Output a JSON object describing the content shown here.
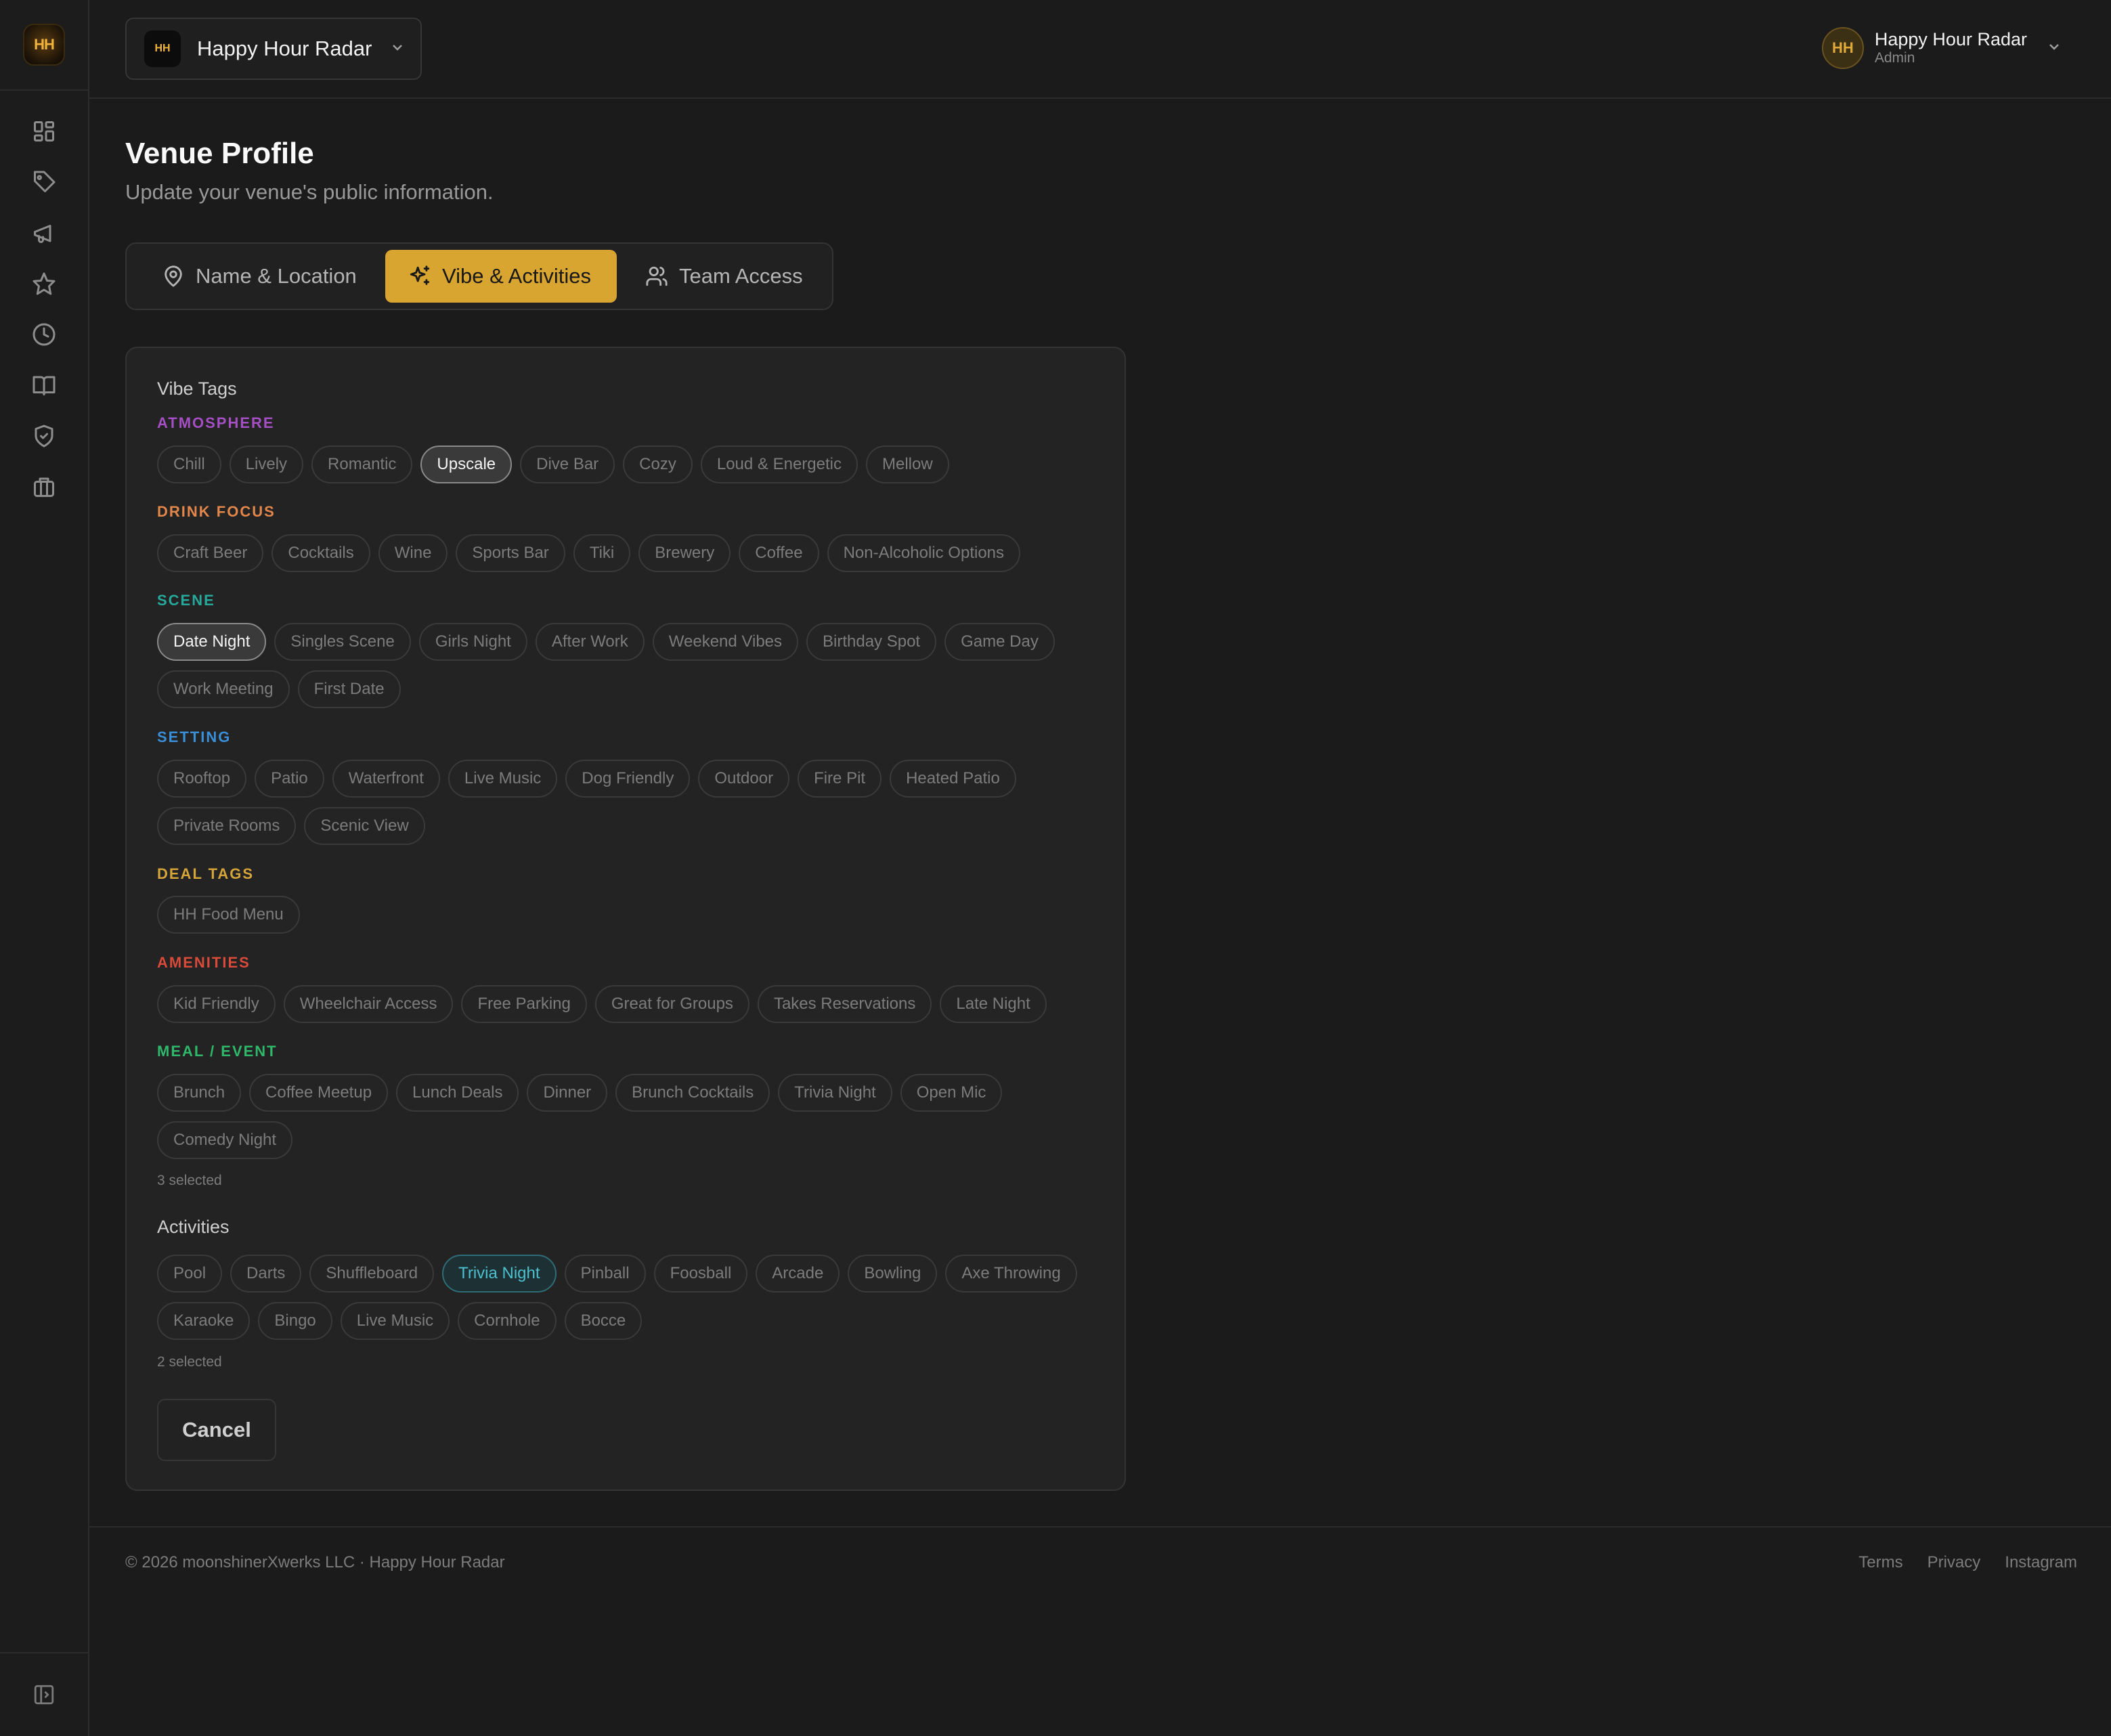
{
  "app": {
    "logo_text": "HH",
    "venue_name": "Happy Hour Radar",
    "user_initials": "HH",
    "user_name": "Happy Hour Radar",
    "user_role": "Admin"
  },
  "sidebar": {
    "items": [
      {
        "icon": "dashboard-icon"
      },
      {
        "icon": "tag-icon"
      },
      {
        "icon": "megaphone-icon"
      },
      {
        "icon": "star-icon"
      },
      {
        "icon": "clock-icon"
      },
      {
        "icon": "book-icon"
      },
      {
        "icon": "shield-check-icon"
      },
      {
        "icon": "briefcase-icon"
      }
    ],
    "bottom_icon": "panel-expand-icon"
  },
  "page": {
    "title": "Venue Profile",
    "subtitle": "Update your venue's public information."
  },
  "tabs": [
    {
      "label": "Name & Location",
      "icon": "map-pin-icon",
      "active": false
    },
    {
      "label": "Vibe & Activities",
      "icon": "sparkles-icon",
      "active": true
    },
    {
      "label": "Team Access",
      "icon": "users-icon",
      "active": false
    }
  ],
  "vibe": {
    "label": "Vibe Tags",
    "categories": [
      {
        "name": "ATMOSPHERE",
        "color": "#a54fc4",
        "tags": [
          "Chill",
          "Lively",
          "Romantic",
          "Upscale",
          "Dive Bar",
          "Cozy",
          "Loud & Energetic",
          "Mellow"
        ],
        "selected": [
          "Upscale"
        ]
      },
      {
        "name": "DRINK FOCUS",
        "color": "#e2864a",
        "tags": [
          "Craft Beer",
          "Cocktails",
          "Wine",
          "Sports Bar",
          "Tiki",
          "Brewery",
          "Coffee",
          "Non-Alcoholic Options"
        ],
        "selected": []
      },
      {
        "name": "SCENE",
        "color": "#26a89a",
        "tags": [
          "Date Night",
          "Singles Scene",
          "Girls Night",
          "After Work",
          "Weekend Vibes",
          "Birthday Spot",
          "Game Day",
          "Work Meeting",
          "First Date"
        ],
        "selected": [
          "Date Night"
        ]
      },
      {
        "name": "SETTING",
        "color": "#3a8fd9",
        "tags": [
          "Rooftop",
          "Patio",
          "Waterfront",
          "Live Music",
          "Dog Friendly",
          "Outdoor",
          "Fire Pit",
          "Heated Patio",
          "Private Rooms",
          "Scenic View"
        ],
        "selected": []
      },
      {
        "name": "DEAL TAGS",
        "color": "#d6a53a",
        "tags": [
          "HH Food Menu"
        ],
        "selected": []
      },
      {
        "name": "AMENITIES",
        "color": "#d94a3a",
        "tags": [
          "Kid Friendly",
          "Wheelchair Access",
          "Free Parking",
          "Great for Groups",
          "Takes Reservations",
          "Late Night"
        ],
        "selected": []
      },
      {
        "name": "MEAL / EVENT",
        "color": "#2fb86a",
        "tags": [
          "Brunch",
          "Coffee Meetup",
          "Lunch Deals",
          "Dinner",
          "Brunch Cocktails",
          "Trivia Night",
          "Open Mic",
          "Comedy Night"
        ],
        "selected": []
      }
    ],
    "count_text": "3 selected"
  },
  "activities": {
    "label": "Activities",
    "tags": [
      "Pool",
      "Darts",
      "Shuffleboard",
      "Trivia Night",
      "Pinball",
      "Foosball",
      "Arcade",
      "Bowling",
      "Axe Throwing",
      "Karaoke",
      "Bingo",
      "Live Music",
      "Cornhole",
      "Bocce"
    ],
    "selected": [
      "Trivia Night"
    ],
    "count_text": "2 selected"
  },
  "actions": {
    "cancel_label": "Cancel"
  },
  "footer": {
    "copyright": "© 2026 moonshinerXwerks LLC · Happy Hour Radar",
    "links": [
      "Terms",
      "Privacy",
      "Instagram"
    ]
  }
}
